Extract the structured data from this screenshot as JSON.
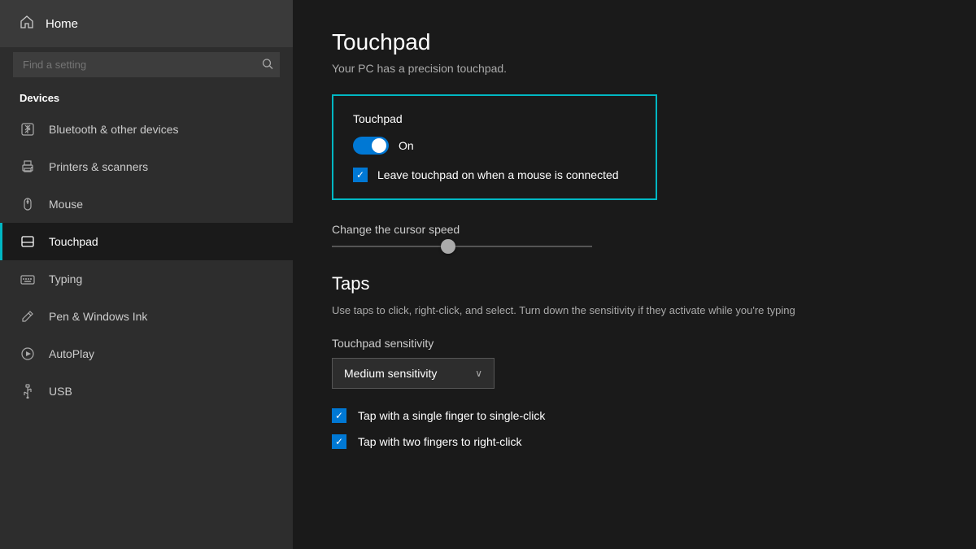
{
  "sidebar": {
    "home_label": "Home",
    "search_placeholder": "Find a setting",
    "section_label": "Devices",
    "items": [
      {
        "id": "bluetooth",
        "label": "Bluetooth & other devices",
        "icon": "bluetooth-icon",
        "active": false
      },
      {
        "id": "printers",
        "label": "Printers & scanners",
        "icon": "printer-icon",
        "active": false
      },
      {
        "id": "mouse",
        "label": "Mouse",
        "icon": "mouse-icon",
        "active": false
      },
      {
        "id": "touchpad",
        "label": "Touchpad",
        "icon": "touchpad-icon",
        "active": true
      },
      {
        "id": "typing",
        "label": "Typing",
        "icon": "typing-icon",
        "active": false
      },
      {
        "id": "pen",
        "label": "Pen & Windows Ink",
        "icon": "pen-icon",
        "active": false
      },
      {
        "id": "autoplay",
        "label": "AutoPlay",
        "icon": "autoplay-icon",
        "active": false
      },
      {
        "id": "usb",
        "label": "USB",
        "icon": "usb-icon",
        "active": false
      }
    ]
  },
  "main": {
    "page_title": "Touchpad",
    "page_subtitle": "Your PC has a precision touchpad.",
    "touchpad_box": {
      "title": "Touchpad",
      "toggle_state": "On",
      "checkbox_label": "Leave touchpad on when a mouse is connected"
    },
    "cursor_speed": {
      "label": "Change the cursor speed"
    },
    "taps": {
      "title": "Taps",
      "description": "Use taps to click, right-click, and select. Turn down the sensitivity if they activate while you're typing",
      "sensitivity_label": "Touchpad sensitivity",
      "sensitivity_value": "Medium sensitivity",
      "chevron": "∨",
      "checkboxes": [
        {
          "id": "single-tap",
          "label": "Tap with a single finger to single-click",
          "checked": true
        },
        {
          "id": "two-finger-tap",
          "label": "Tap with two fingers to right-click",
          "checked": true
        }
      ]
    }
  }
}
